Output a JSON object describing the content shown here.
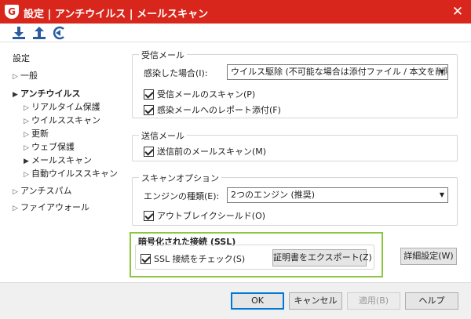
{
  "window": {
    "logo_letter": "G",
    "title": "設定 | アンチウイルス | メールスキャン",
    "close": "✕"
  },
  "toolbar": {
    "icons": [
      "download-icon",
      "upload-icon",
      "reset-icon"
    ]
  },
  "sidebar": {
    "heading": "設定",
    "items": [
      {
        "label": "一般"
      },
      {
        "label": "アンチウイルス"
      },
      {
        "label": "リアルタイム保護"
      },
      {
        "label": "ウイルススキャン"
      },
      {
        "label": "更新"
      },
      {
        "label": "ウェブ保護"
      },
      {
        "label": "メールスキャン"
      },
      {
        "label": "自動ウイルススキャン"
      },
      {
        "label": "アンチスパム"
      },
      {
        "label": "ファイアウォール"
      }
    ]
  },
  "incoming": {
    "title": "受信メール",
    "infected_label": "感染した場合(I):",
    "infected_value": "ウイルス駆除 (不可能な場合は添付ファイル / 本文を削除)",
    "scan_incoming": "受信メールのスキャン(P)",
    "attach_report": "感染メールへのレポート添付(F)"
  },
  "outgoing": {
    "title": "送信メール",
    "scan_before_send": "送信前のメールスキャン(M)"
  },
  "scan_options": {
    "title": "スキャンオプション",
    "engine_label": "エンジンの種類(E):",
    "engine_value": "2つのエンジン (推奨)",
    "outbreak_shield": "アウトブレイクシールド(O)"
  },
  "ssl": {
    "title": "暗号化された接続 (SSL)",
    "ssl_check": "SSL 接続をチェック(S)",
    "export_cert": "証明書をエクスポート(Z)"
  },
  "advanced_button": "詳細設定(W)",
  "footer": {
    "ok": "OK",
    "cancel": "キャンセル",
    "apply": "適用(B)",
    "help": "ヘルプ"
  },
  "colors": {
    "titlebar": "#d9261c",
    "highlight": "#8cc63f",
    "icon": "#2a5d9f"
  }
}
